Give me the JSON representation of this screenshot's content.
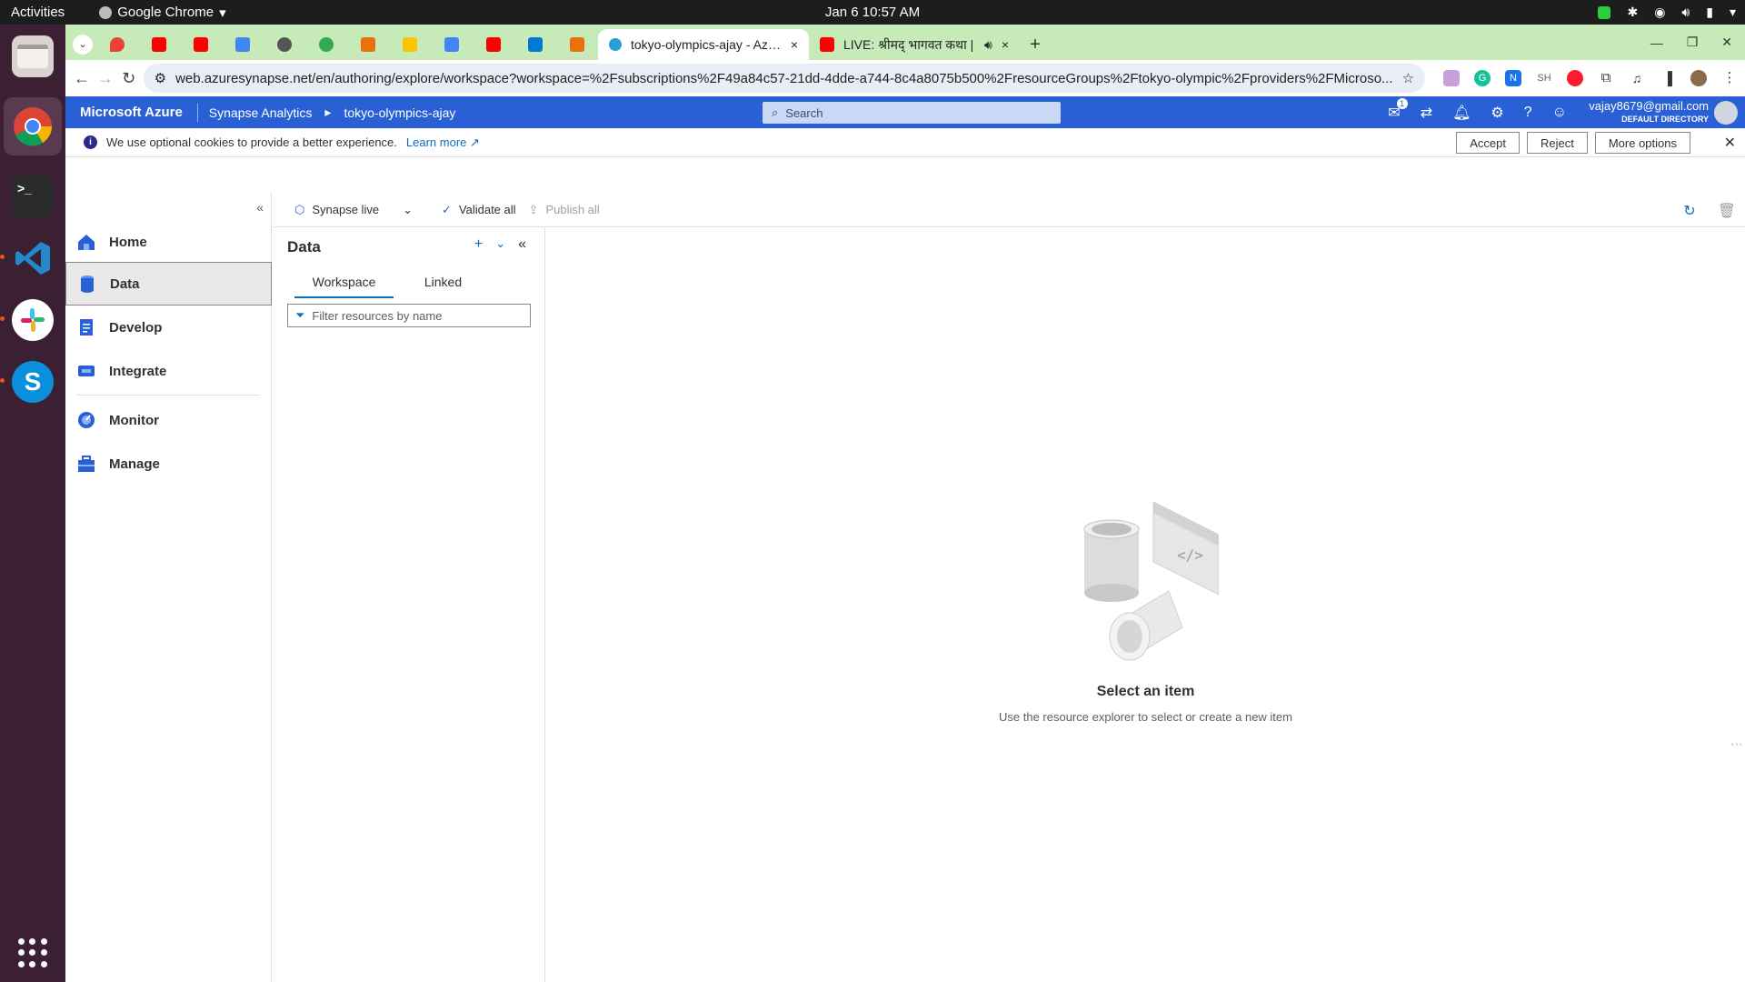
{
  "topbar": {
    "activities": "Activities",
    "app_name": "Google Chrome",
    "clock": "Jan 6  10:57 AM"
  },
  "chrome": {
    "tabs": [
      {
        "title": "tokyo-olympics-ajay - Azure",
        "close": "×"
      },
      {
        "title": "LIVE: श्रीमद् भागवत कथा |",
        "close": "×"
      }
    ],
    "new_tab": "+",
    "url": "web.azuresynapse.net/en/authoring/explore/workspace?workspace=%2Fsubscriptions%2F49a84c57-21dd-4dde-a744-8c4a8075b500%2FresourceGroups%2Ftokyo-olympic%2Fproviders%2FMicroso..."
  },
  "azure": {
    "brand": "Microsoft Azure",
    "breadcrumb": [
      "Synapse Analytics",
      "tokyo-olympics-ajay"
    ],
    "search_placeholder": "Search",
    "notification_count": "1",
    "user_email": "vajay8679@gmail.com",
    "user_directory": "DEFAULT DIRECTORY"
  },
  "cookie": {
    "message": "We use optional cookies to provide a better experience.",
    "learn_more": "Learn more",
    "accept": "Accept",
    "reject": "Reject",
    "more_options": "More options"
  },
  "nav": {
    "items": [
      {
        "label": "Home"
      },
      {
        "label": "Data"
      },
      {
        "label": "Develop"
      },
      {
        "label": "Integrate"
      },
      {
        "label": "Monitor"
      },
      {
        "label": "Manage"
      }
    ],
    "selected": "Data"
  },
  "commandbar": {
    "mode": "Synapse live",
    "validate_all": "Validate all",
    "publish_all": "Publish all"
  },
  "data_panel": {
    "title": "Data",
    "tabs": [
      "Workspace",
      "Linked"
    ],
    "active_tab": "Workspace",
    "filter_placeholder": "Filter resources by name"
  },
  "empty_state": {
    "heading": "Select an item",
    "subtext": "Use the resource explorer to select or create a new item"
  },
  "colors": {
    "azure_blue": "#2a60d5",
    "tabstrip_green": "#c6ebb9",
    "dock_bg": "#3b1f33"
  }
}
